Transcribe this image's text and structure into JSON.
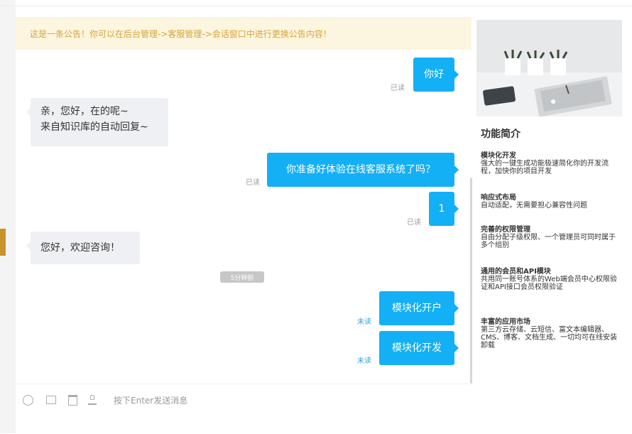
{
  "notice": {
    "text": "这是一条公告！你可以在后台管理->客服管理->会话窗口中进行更换公告内容！"
  },
  "messages": [
    {
      "id": "m1",
      "direction": "out",
      "text": "你好",
      "status": "已读"
    },
    {
      "id": "m2",
      "direction": "in",
      "lines": [
        "亲，您好，在的呢~",
        "来自知识库的自动回复~"
      ]
    },
    {
      "id": "m3",
      "direction": "out",
      "text": "你准备好体验在线客服系统了吗？",
      "status": "已读"
    },
    {
      "id": "m4",
      "direction": "out",
      "text": "1",
      "status": "已读"
    },
    {
      "id": "m5",
      "direction": "in",
      "text": "您好，欢迎咨询！"
    },
    {
      "id": "m6",
      "direction": "out",
      "text": "模块化开户",
      "status": "未读"
    },
    {
      "id": "m7",
      "direction": "out",
      "text": "模块化开发",
      "status": "未读"
    }
  ],
  "time_divider": "5分钟前",
  "input": {
    "placeholder": "按下Enter发送消息"
  },
  "sidebar": {
    "title": "功能简介",
    "features": [
      {
        "title": "模块化开发",
        "desc": "强大的一键生成功能极速简化你的开发流程，加快你的项目开发"
      },
      {
        "title": "响应式布局",
        "desc": "自动适配，无需要担心兼容性问题"
      },
      {
        "title": "完善的权限管理",
        "desc": "自由分配子级权限、一个管理员可同时属于多个组别"
      },
      {
        "title": "通用的会员和API模块",
        "desc": "共用同一账号体系的Web端会员中心权限验证和API接口会员权限验证"
      },
      {
        "title": "丰富的应用市场",
        "desc": "第三方云存储、云短信、富文本编辑器、CMS、博客、文档生成、一切均可在线安装卸载"
      }
    ]
  },
  "colors": {
    "accent": "#14b0f5",
    "notice_bg": "#fcf5df",
    "notice_text": "#d8a53b",
    "incoming_bg": "#eef0f3",
    "unread": "#2ea6e0"
  },
  "icons": [
    "emoji-icon",
    "folder-icon",
    "save-icon",
    "user-card-icon"
  ]
}
